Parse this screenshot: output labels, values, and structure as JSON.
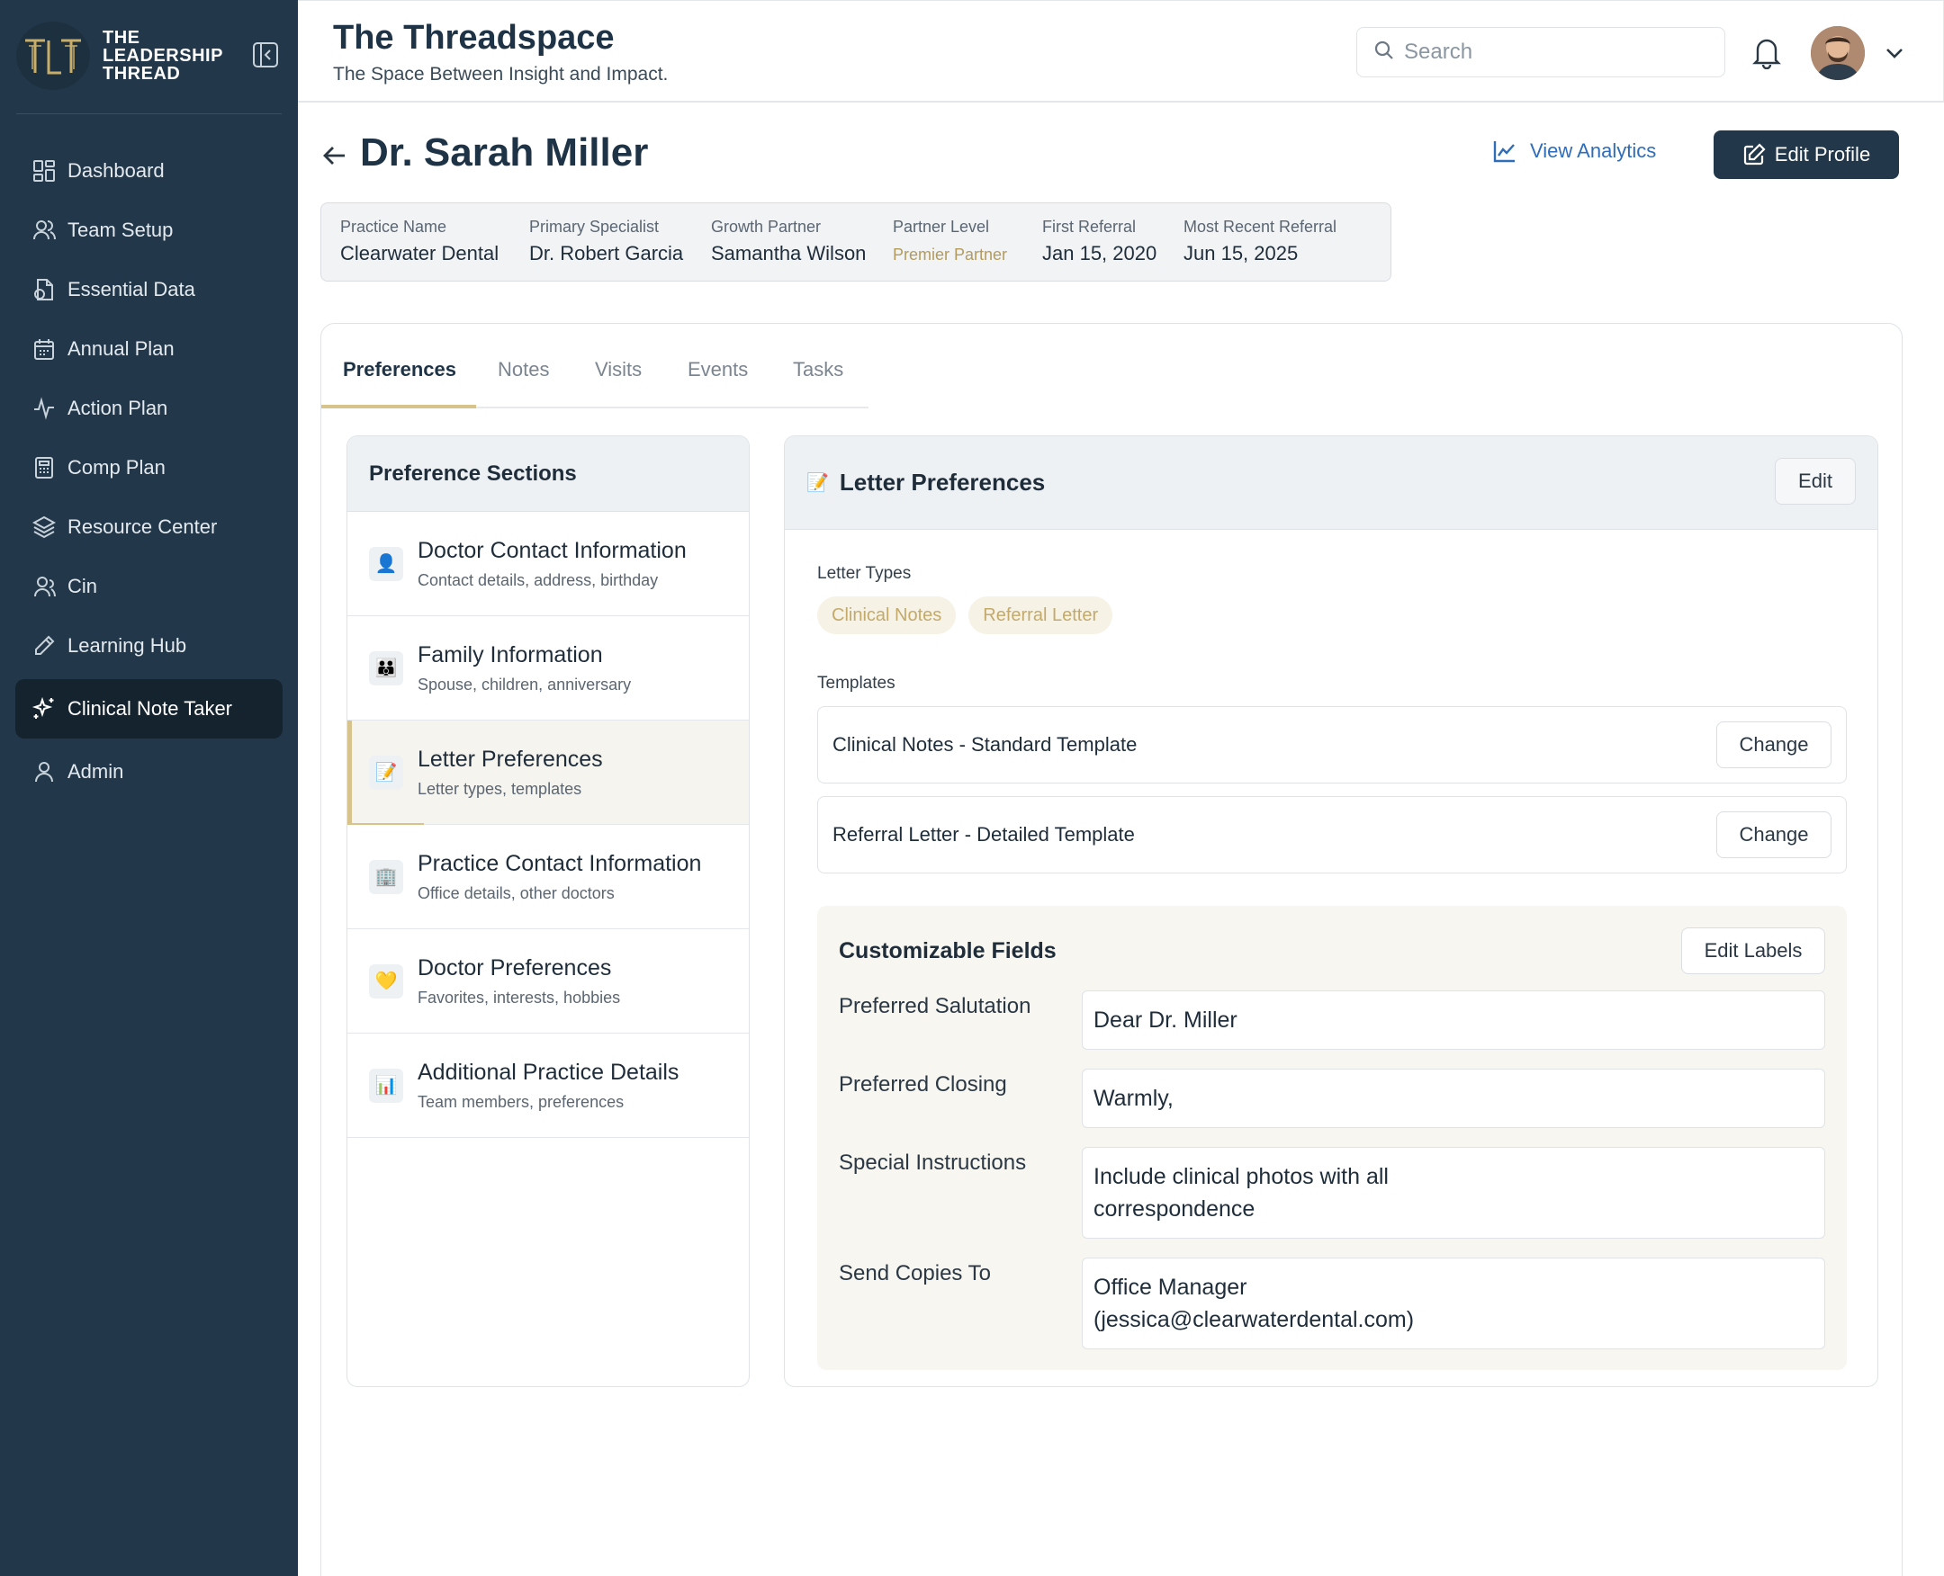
{
  "sidebar": {
    "brand": "THE LEADERSHIP THREAD",
    "items": [
      {
        "label": "Dashboard",
        "icon": "dashboard-icon"
      },
      {
        "label": "Team Setup",
        "icon": "users-icon"
      },
      {
        "label": "Essential Data",
        "icon": "data-icon"
      },
      {
        "label": "Annual Plan",
        "icon": "calendar-icon"
      },
      {
        "label": "Action Plan",
        "icon": "activity-icon"
      },
      {
        "label": "Comp Plan",
        "icon": "calculator-icon"
      },
      {
        "label": "Resource Center",
        "icon": "layers-icon"
      },
      {
        "label": "Cin",
        "icon": "user-group-icon"
      },
      {
        "label": "Learning Hub",
        "icon": "pencil-icon"
      },
      {
        "label": "Clinical Note Taker",
        "icon": "sparkle-icon",
        "active": true
      },
      {
        "label": "Admin",
        "icon": "user-icon"
      }
    ]
  },
  "header": {
    "title": "The Threadspace",
    "subtitle": "The Space Between Insight and Impact.",
    "search_placeholder": "Search"
  },
  "profile": {
    "name": "Dr. Sarah Miller",
    "view_analytics": "View Analytics",
    "edit_profile": "Edit Profile",
    "info": [
      {
        "label": "Practice Name",
        "value": "Clearwater Dental"
      },
      {
        "label": "Primary Specialist",
        "value": "Dr. Robert Garcia"
      },
      {
        "label": "Growth Partner",
        "value": "Samantha Wilson"
      },
      {
        "label": "Partner Level",
        "value": "Premier Partner"
      },
      {
        "label": "First Referral",
        "value": "Jan 15, 2020"
      },
      {
        "label": "Most Recent Referral",
        "value": "Jun 15, 2025"
      }
    ]
  },
  "tabs": [
    "Preferences",
    "Notes",
    "Visits",
    "Events",
    "Tasks"
  ],
  "preference_sections": {
    "title": "Preference Sections",
    "items": [
      {
        "title": "Doctor Contact Information",
        "desc": "Contact details, address, birthday",
        "icon": "👤"
      },
      {
        "title": "Family Information",
        "desc": "Spouse, children, anniversary",
        "icon": "👪"
      },
      {
        "title": "Letter Preferences",
        "desc": "Letter types, templates",
        "icon": "📝"
      },
      {
        "title": "Practice Contact Information",
        "desc": "Office details, other doctors",
        "icon": "🏢"
      },
      {
        "title": "Doctor Preferences",
        "desc": "Favorites, interests, hobbies",
        "icon": "💛"
      },
      {
        "title": "Additional Practice Details",
        "desc": "Team members, preferences",
        "icon": "📊"
      }
    ]
  },
  "letter_preferences": {
    "title": "Letter Preferences",
    "icon": "📝",
    "edit": "Edit",
    "letter_types_label": "Letter Types",
    "letter_types": [
      "Clinical Notes",
      "Referral Letter"
    ],
    "templates_label": "Templates",
    "templates": [
      {
        "name": "Clinical Notes - Standard Template",
        "action": "Change"
      },
      {
        "name": "Referral Letter - Detailed Template",
        "action": "Change"
      }
    ],
    "customizable": {
      "title": "Customizable Fields",
      "edit_labels": "Edit Labels",
      "fields": [
        {
          "label": "Preferred Salutation",
          "value": "Dear Dr. Miller"
        },
        {
          "label": "Preferred Closing",
          "value": "Warmly,"
        },
        {
          "label": "Special Instructions",
          "value": "Include clinical photos with all correspondence"
        },
        {
          "label": "Send Copies To",
          "value": "Office Manager (jessica@clearwaterdental.com)"
        }
      ]
    }
  },
  "colors": {
    "sidebar_bg": "#22384a",
    "accent_gold": "#d9c38d",
    "link_blue": "#2f6db8"
  }
}
